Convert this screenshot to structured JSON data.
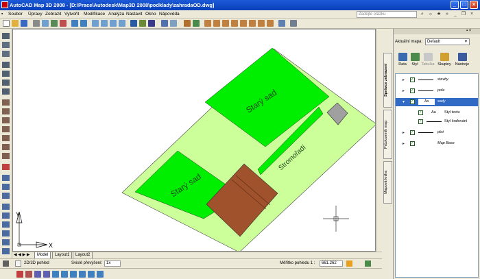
{
  "window": {
    "title": "AutoCAD Map 3D 2008 - [D:\\Prace\\Autodesk\\Map3D 2008\\podklady\\zahradaOD.dwg]"
  },
  "menu": {
    "items": [
      "Soubor",
      "Úpravy",
      "Zobrazit",
      "Vytvořit",
      "Modifikace",
      "Analýza",
      "Nastavit",
      "Okno",
      "Nápověda"
    ],
    "search_placeholder": "Zadejte otázku"
  },
  "drawing": {
    "labels": [
      "Starý sad",
      "Starý sad",
      "Stromořadí"
    ],
    "ucs_x": "X",
    "ucs_y": "Y",
    "colors": {
      "parcel": "#ccff99",
      "orchard": "#00ee00",
      "house": "#a0522d",
      "shed": "#a0a0a0"
    }
  },
  "layout_tabs": [
    "Model",
    "Layout1",
    "Layout2"
  ],
  "status": {
    "view_mode": "2D/3D pohled",
    "annotation_scale_label": "Svislé převýšení:",
    "annotation_scale_value": "1x",
    "viewport_scale_label": "Měřítko pohledu 1 :",
    "viewport_scale_value": "661.262"
  },
  "panel": {
    "side_tabs": [
      "Správce zobrazení",
      "Průzkumník map",
      "Mapová kniha"
    ],
    "map_label": "Aktuální mapa:",
    "map_value": "Default",
    "buttons": [
      "Data",
      "Styl",
      "Tabulka",
      "Skupiny",
      "Nástroje"
    ],
    "layers": [
      {
        "name": "stavby",
        "checked": true,
        "selected": false
      },
      {
        "name": "pole",
        "checked": true,
        "selected": false
      },
      {
        "name": "sady",
        "checked": true,
        "selected": true,
        "swatch": "Aa"
      },
      {
        "name": "plot",
        "checked": true,
        "selected": false
      },
      {
        "name": "Map Base",
        "checked": true,
        "selected": false
      }
    ],
    "sublayers": [
      {
        "swatch": "Aa",
        "name": "Styl textu"
      },
      {
        "name": "Styl šrafování"
      }
    ]
  }
}
